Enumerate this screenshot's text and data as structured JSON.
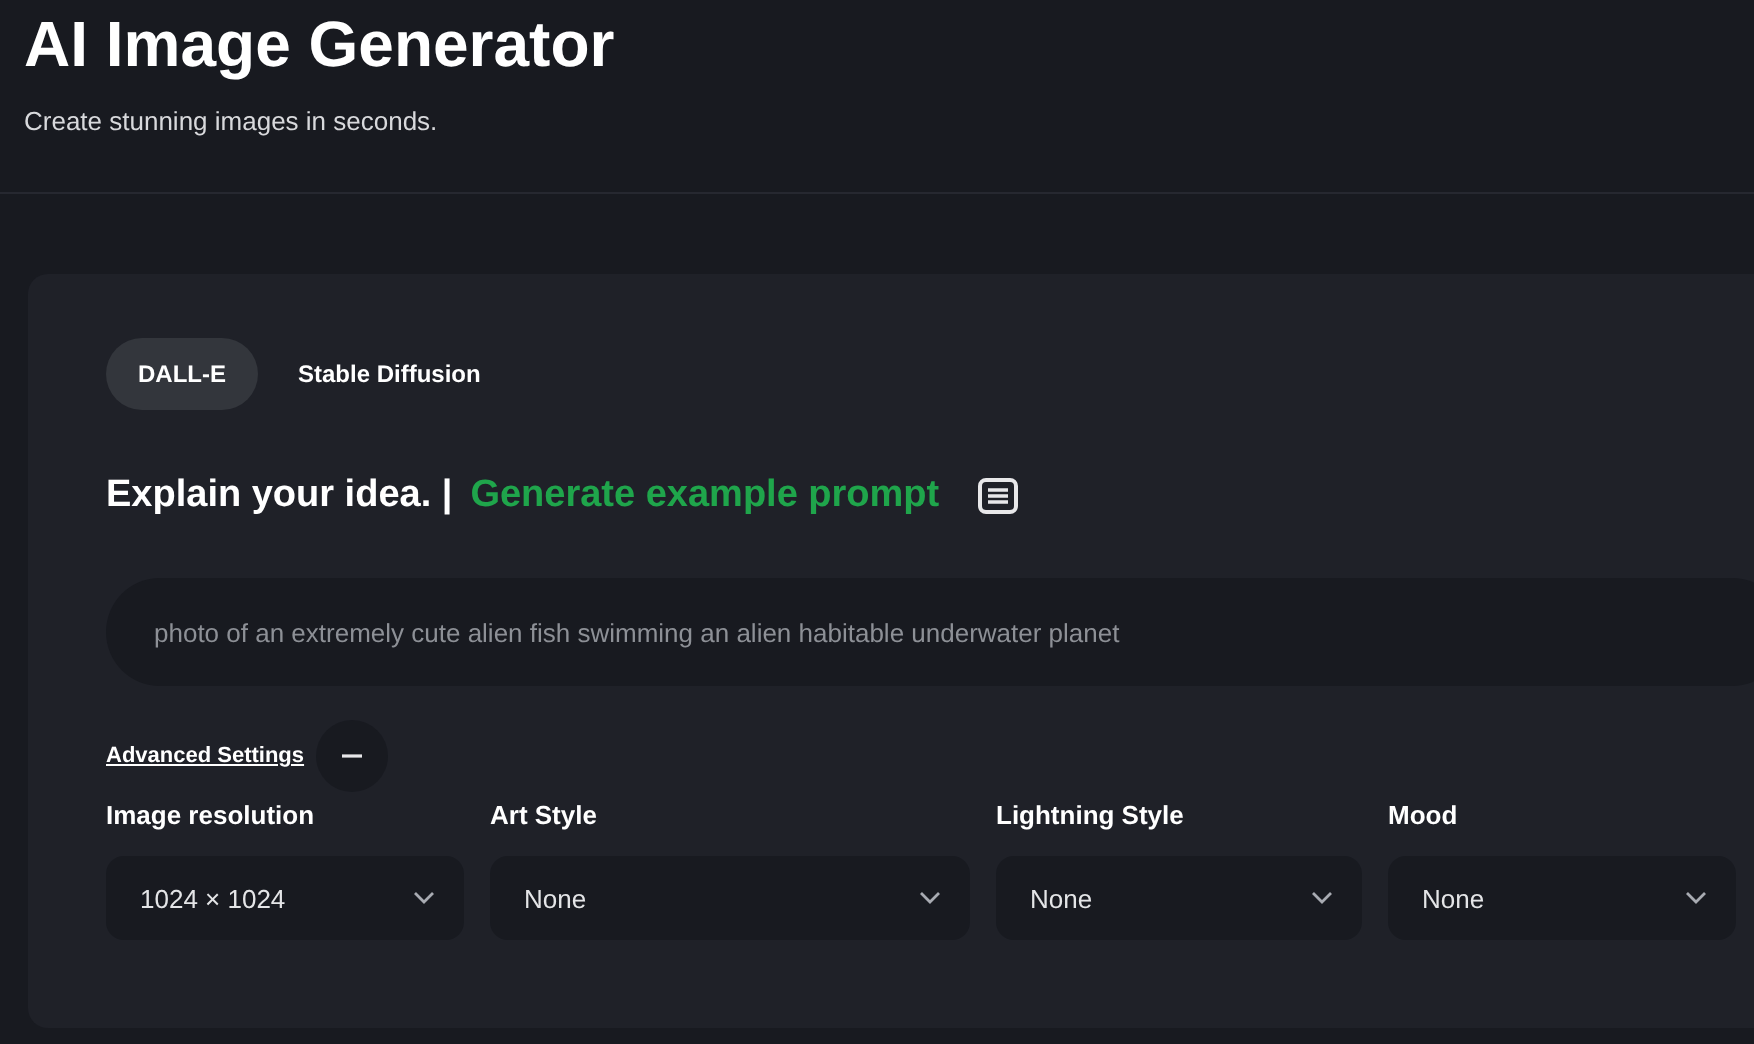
{
  "header": {
    "title": "AI Image Generator",
    "subtitle": "Create stunning images in seconds."
  },
  "model_tabs": [
    {
      "label": "DALL-E",
      "selected": true
    },
    {
      "label": "Stable Diffusion",
      "selected": false
    }
  ],
  "prompt_heading": {
    "label": "Explain your idea. |",
    "link": "Generate example prompt"
  },
  "prompt_field": {
    "placeholder": "photo of an extremely cute alien fish swimming an alien habitable underwater planet"
  },
  "advanced_settings": {
    "label": "Advanced Settings",
    "expanded": true
  },
  "settings": [
    {
      "label": "Image resolution",
      "value": "1024 × 1024"
    },
    {
      "label": "Art Style",
      "value": "None"
    },
    {
      "label": "Lightning Style",
      "value": "None"
    },
    {
      "label": "Mood",
      "value": "None"
    }
  ]
}
